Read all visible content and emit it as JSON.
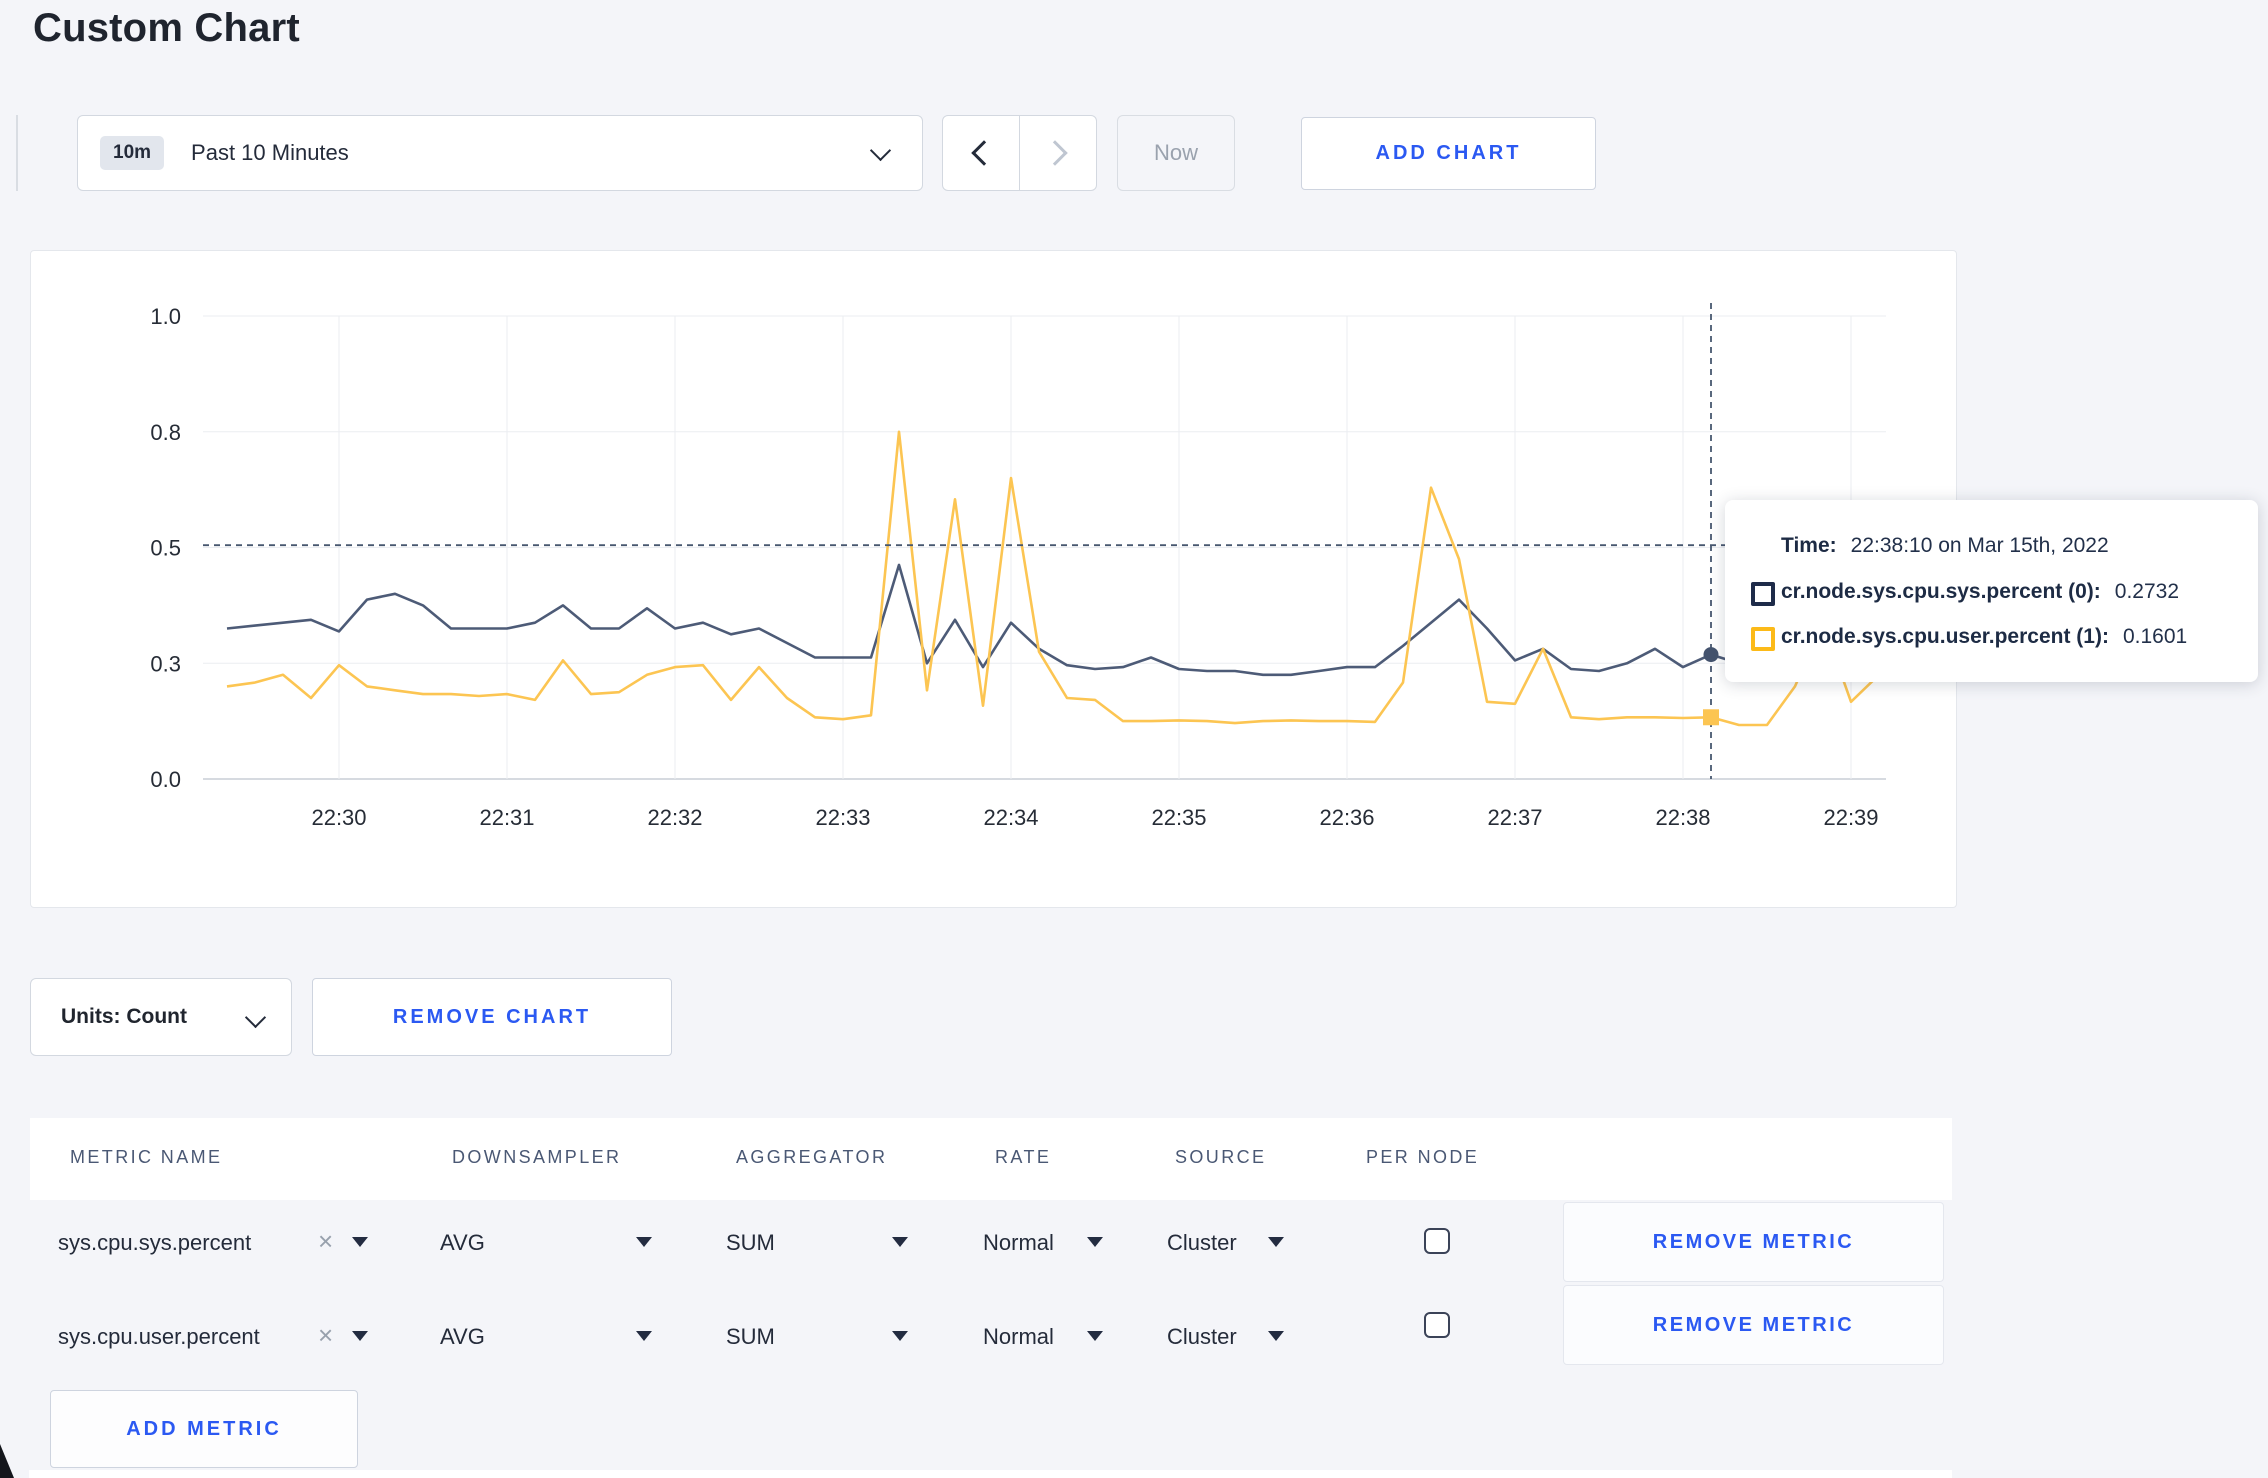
{
  "page": {
    "title": "Custom Chart"
  },
  "toolbar": {
    "time_badge": "10m",
    "time_label": "Past 10 Minutes",
    "now_label": "Now",
    "add_chart_label": "ADD CHART"
  },
  "chart_data": {
    "type": "line",
    "title": "",
    "xlabel": "",
    "ylabel": "",
    "ylim": [
      0.0,
      1.0
    ],
    "grid": true,
    "x_start_time": "22:29:20",
    "x_interval_seconds": 10,
    "x_ticks": [
      "22:30",
      "22:31",
      "22:32",
      "22:33",
      "22:34",
      "22:35",
      "22:36",
      "22:37",
      "22:38",
      "22:39"
    ],
    "y_ticks": [
      0.0,
      0.3,
      0.5,
      0.8,
      1.0
    ],
    "y_tick_labels": [
      "0.0",
      "0.3",
      "0.5",
      "0.8",
      "1.0"
    ],
    "series": [
      {
        "name": "cr.node.sys.cpu.sys.percent (0)",
        "color": "#4d5b77",
        "data_name": "sys-series-line",
        "values": [
          0.36,
          0.365,
          0.37,
          0.375,
          0.355,
          0.41,
          0.42,
          0.4,
          0.36,
          0.36,
          0.36,
          0.37,
          0.4,
          0.36,
          0.36,
          0.395,
          0.36,
          0.37,
          0.35,
          0.36,
          0.335,
          0.31,
          0.31,
          0.31,
          0.47,
          0.3,
          0.375,
          0.29,
          0.37,
          0.325,
          0.295,
          0.285,
          0.29,
          0.31,
          0.285,
          0.28,
          0.28,
          0.27,
          0.27,
          0.28,
          0.29,
          0.29,
          0.33,
          0.37,
          0.41,
          0.36,
          0.305,
          0.325,
          0.285,
          0.28,
          0.3,
          0.325,
          0.29,
          0.315,
          0.3,
          0.295,
          0.3,
          0.31,
          0.3,
          0.31
        ]
      },
      {
        "name": "cr.node.sys.cpu.user.percent (1)",
        "color": "#fcc552",
        "data_name": "user-series-line",
        "values": [
          0.24,
          0.25,
          0.27,
          0.21,
          0.295,
          0.24,
          0.23,
          0.22,
          0.22,
          0.215,
          0.22,
          0.205,
          0.305,
          0.22,
          0.225,
          0.27,
          0.29,
          0.295,
          0.205,
          0.29,
          0.21,
          0.16,
          0.155,
          0.165,
          0.8,
          0.23,
          0.625,
          0.19,
          0.68,
          0.32,
          0.21,
          0.205,
          0.15,
          0.15,
          0.152,
          0.15,
          0.145,
          0.15,
          0.152,
          0.15,
          0.15,
          0.148,
          0.25,
          0.655,
          0.48,
          0.2,
          0.195,
          0.325,
          0.16,
          0.155,
          0.16,
          0.16,
          0.158,
          0.16,
          0.14,
          0.14,
          0.24,
          0.37,
          0.2,
          0.27
        ]
      }
    ],
    "crosshair": {
      "index": 53,
      "time": "22:38:10",
      "y_value": 0.506
    }
  },
  "tooltip": {
    "time_label": "Time:",
    "time_value": "22:38:10 on Mar 15th, 2022",
    "rows": [
      {
        "label": "cr.node.sys.cpu.sys.percent (0):",
        "value": "0.2732",
        "swatch_color": "#1e2b49"
      },
      {
        "label": "cr.node.sys.cpu.user.percent (1):",
        "value": "0.1601",
        "swatch_color": "#fcba18"
      }
    ]
  },
  "chart_footer": {
    "units_label": "Units: Count",
    "remove_chart_label": "REMOVE CHART"
  },
  "metrics_table": {
    "headers": [
      "METRIC NAME",
      "DOWNSAMPLER",
      "AGGREGATOR",
      "RATE",
      "SOURCE",
      "PER NODE"
    ],
    "remove_tag_glyph": "×",
    "rows": [
      {
        "name": "sys.cpu.sys.percent",
        "downsampler": "AVG",
        "aggregator": "SUM",
        "rate": "Normal",
        "source": "Cluster",
        "per_node_checked": false,
        "remove_label": "REMOVE METRIC"
      },
      {
        "name": "sys.cpu.user.percent",
        "downsampler": "AVG",
        "aggregator": "SUM",
        "rate": "Normal",
        "source": "Cluster",
        "per_node_checked": false,
        "remove_label": "REMOVE METRIC"
      }
    ],
    "add_metric_label": "ADD METRIC"
  },
  "colors": {
    "accent_blue": "#2b59f2",
    "series_sys": "#4d5b77",
    "series_user": "#fcc552",
    "page_background": "#f4f5f9",
    "crosshair": "#47576f"
  }
}
